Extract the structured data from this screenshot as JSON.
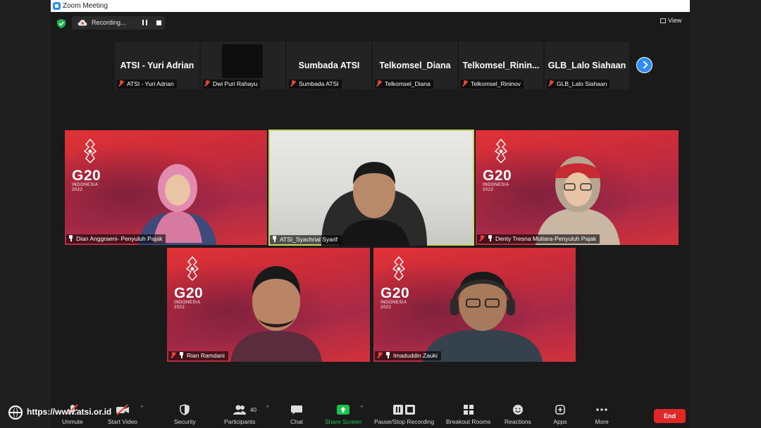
{
  "window": {
    "title": "Zoom Meeting"
  },
  "topbar": {
    "recording_label": "Recording...",
    "view_label": "View"
  },
  "thumbnails": [
    {
      "display": "ATSI - Yuri Adrian",
      "name": "ATSI - Yuri Adrian"
    },
    {
      "display": "",
      "name": "Dwi Puri Rahayu"
    },
    {
      "display": "Sumbada ATSI",
      "name": "Sumbada ATSI"
    },
    {
      "display": "Telkomsel_Diana",
      "name": "Telkomsel_Diana"
    },
    {
      "display": "Telkomsel_Rinin...",
      "name": "Telkomsel_Rininov"
    },
    {
      "display": "GLB_Lalo Siahaan",
      "name": "GLB_Lalo Siahaan"
    }
  ],
  "g20": {
    "logo_text": "G20",
    "sub1": "INDONESIA",
    "sub2": "2022"
  },
  "tiles": [
    {
      "name": "Dian Anggraeni- Penyuluh Pajak"
    },
    {
      "name": "ATSI_Syachrial Syarif"
    },
    {
      "name": "Denty Tresna Mutiara-Penyuluh Pajak"
    },
    {
      "name": "Rian Ramdani"
    },
    {
      "name": "Imaduddin Zauki"
    }
  ],
  "toolbar": {
    "unmute": "Unmute",
    "start_video": "Start Video",
    "security": "Security",
    "participants": "Participants",
    "participant_count": "40",
    "chat": "Chat",
    "share_screen": "Share Screen",
    "pause_stop_recording": "Pause/Stop Recording",
    "breakout_rooms": "Breakout Rooms",
    "reactions": "Reactions",
    "apps": "Apps",
    "more": "More",
    "end": "End"
  },
  "watermark": {
    "url": "https://www.atsi.or.id"
  },
  "colors": {
    "accent_blue": "#2d8cff",
    "share_green": "#17c54a",
    "end_red": "#e02828",
    "active_speaker": "#c6d95e",
    "muted_red": "#e5453b"
  }
}
